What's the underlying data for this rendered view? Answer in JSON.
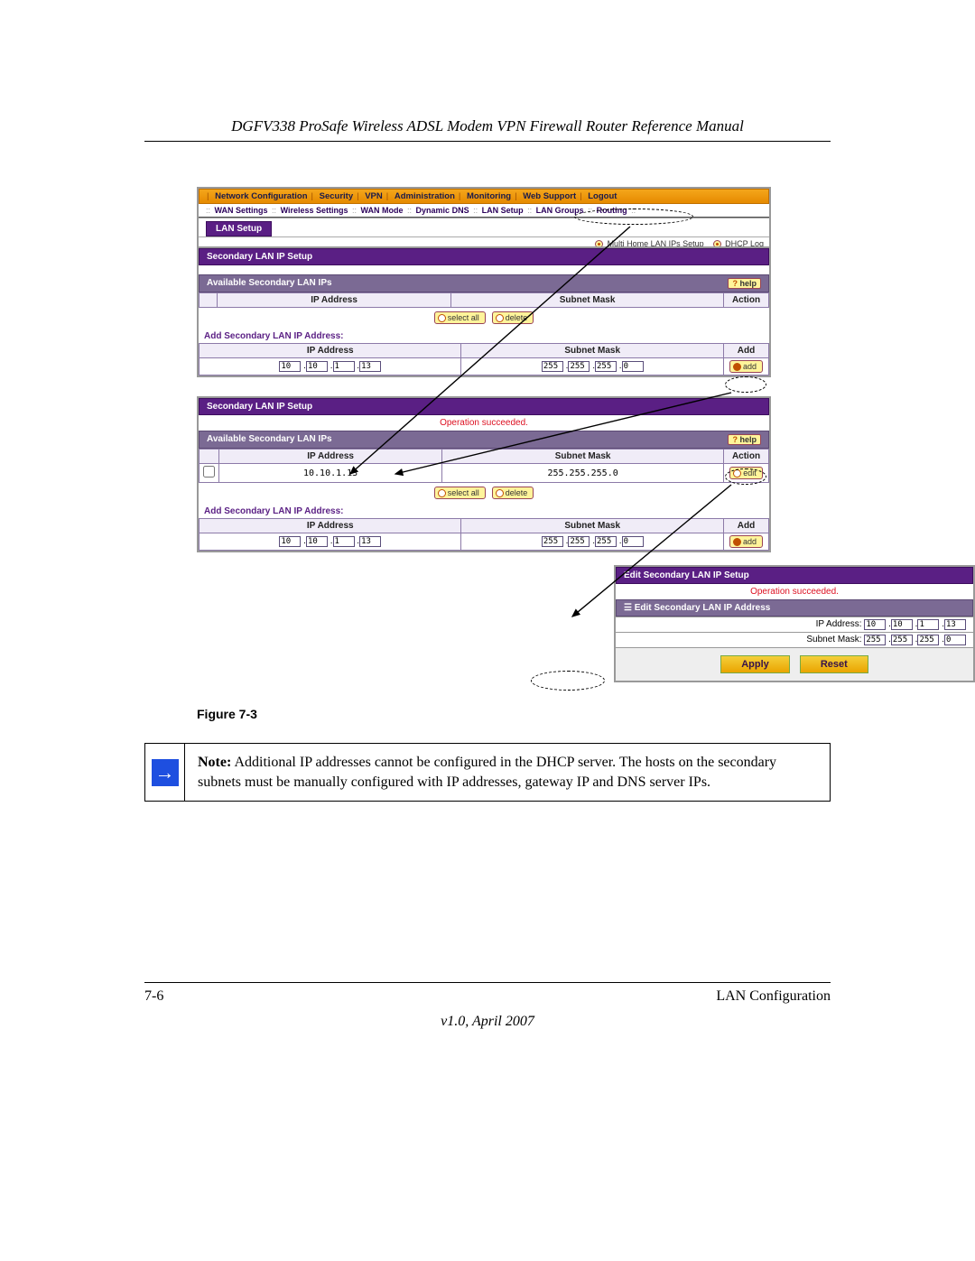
{
  "doc": {
    "title": "DGFV338 ProSafe Wireless ADSL Modem VPN Firewall Router Reference Manual",
    "figure_label": "Figure 7-3",
    "note_bold": "Note:",
    "note_text": "Additional IP addresses cannot be configured in the DHCP server. The hosts on the secondary subnets must be manually configured with IP addresses, gateway IP and DNS server IPs.",
    "page_num": "7-6",
    "section_name": "LAN Configuration",
    "version": "v1.0, April 2007"
  },
  "topnav": {
    "items": [
      "Network Configuration",
      "Security",
      "VPN",
      "Administration",
      "Monitoring",
      "Web Support",
      "Logout"
    ]
  },
  "subnav": {
    "items": [
      "WAN Settings",
      "Wireless Settings",
      "WAN Mode",
      "Dynamic DNS",
      "LAN Setup",
      "LAN Groups",
      "Routing"
    ]
  },
  "tabs": {
    "lan_setup": "LAN Setup"
  },
  "sublinks": {
    "a": "Multi Home LAN IPs Setup",
    "b": "DHCP Log"
  },
  "panel1": {
    "header": "Secondary LAN IP Setup",
    "avail_header": "Available Secondary LAN IPs",
    "help": "help",
    "cols": {
      "ip": "IP Address",
      "mask": "Subnet Mask",
      "action": "Action"
    },
    "select_all": "select all",
    "delete": "delete",
    "add_header": "Add Secondary LAN IP Address:",
    "cols2": {
      "ip": "IP Address",
      "mask": "Subnet Mask",
      "add": "Add"
    },
    "ip": [
      "10",
      "10",
      "1",
      "13"
    ],
    "mask": [
      "255",
      "255",
      "255",
      "0"
    ],
    "add_btn": "add"
  },
  "panel2": {
    "header": "Secondary LAN IP Setup",
    "status": "Operation succeeded.",
    "avail_header": "Available Secondary LAN IPs",
    "help": "help",
    "cols": {
      "ip": "IP Address",
      "mask": "Subnet Mask",
      "action": "Action"
    },
    "row_ip": "10.10.1.13",
    "row_mask": "255.255.255.0",
    "edit_btn": "edit",
    "select_all": "select all",
    "delete": "delete",
    "add_header": "Add Secondary LAN IP Address:",
    "cols2": {
      "ip": "IP Address",
      "mask": "Subnet Mask",
      "add": "Add"
    },
    "ip": [
      "10",
      "10",
      "1",
      "13"
    ],
    "mask": [
      "255",
      "255",
      "255",
      "0"
    ],
    "add_btn": "add"
  },
  "panel3": {
    "header": "Edit Secondary LAN IP Setup",
    "status": "Operation succeeded.",
    "sub_header": "Edit Secondary LAN IP Address",
    "ip_label": "IP Address:",
    "mask_label": "Subnet Mask:",
    "ip": [
      "10",
      "10",
      "1",
      "13"
    ],
    "mask": [
      "255",
      "255",
      "255",
      "0"
    ],
    "apply": "Apply",
    "reset": "Reset"
  }
}
